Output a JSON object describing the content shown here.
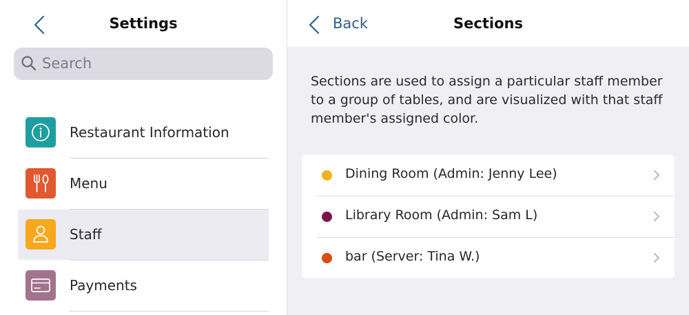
{
  "left_panel": {
    "title": "Settings",
    "search": {
      "placeholder": "Search"
    },
    "items": [
      {
        "label": "Restaurant Information",
        "icon": "info-icon",
        "color": "#1f9ea1"
      },
      {
        "label": "Menu",
        "icon": "fork-knife-icon",
        "color": "#e1592e"
      },
      {
        "label": "Staff",
        "icon": "person-icon",
        "color": "#f7a81c",
        "selected": true
      },
      {
        "label": "Payments",
        "icon": "card-icon",
        "color": "#a2738e"
      }
    ]
  },
  "right_panel": {
    "back_label": "Back",
    "title": "Sections",
    "description": "Sections are used to assign a particular staff member to a group of tables, and are visualized with that staff member's assigned color.",
    "sections": [
      {
        "label": "Dining Room (Admin: Jenny Lee)",
        "color": "#f3b21d"
      },
      {
        "label": "Library Room (Admin: Sam L)",
        "color": "#7b1746"
      },
      {
        "label": "bar (Server: Tina W.)",
        "color": "#dc4a16"
      }
    ]
  },
  "colors": {
    "accent": "#2e5f8a",
    "background": "#efeff4"
  }
}
